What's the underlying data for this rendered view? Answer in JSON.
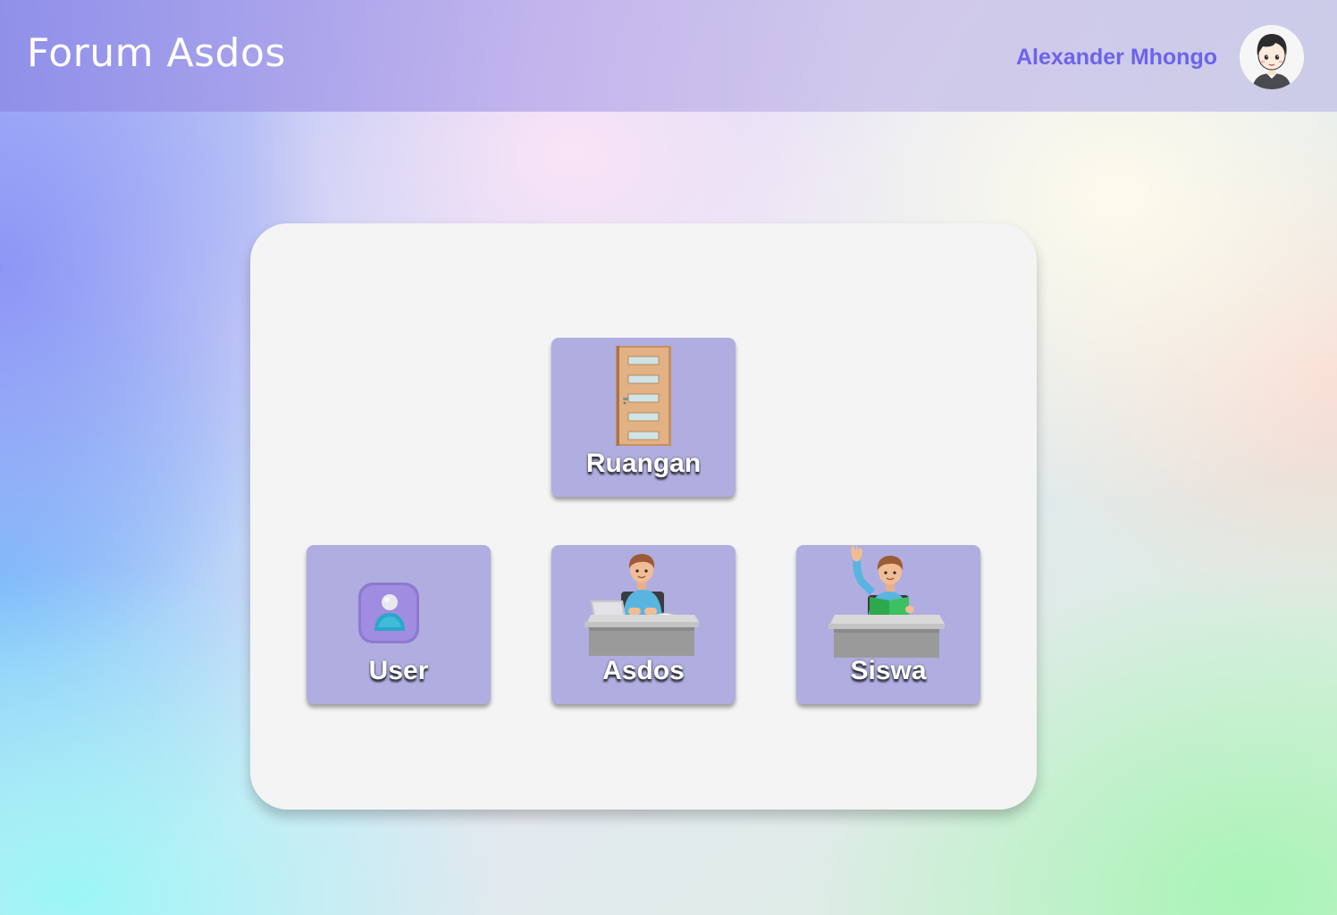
{
  "header": {
    "title": "Forum Asdos",
    "user_name": "Alexander Mhongo",
    "avatar_icon": "cartoon-avatar-icon"
  },
  "menu": {
    "tiles": [
      {
        "label": "Ruangan",
        "icon": "door-icon"
      },
      {
        "label": "User",
        "icon": "user-profile-icon"
      },
      {
        "label": "Asdos",
        "icon": "teacher-at-desk-icon"
      },
      {
        "label": "Siswa",
        "icon": "student-raising-hand-icon"
      }
    ]
  },
  "colors": {
    "header_text": "#ffffff",
    "user_name": "#6c63ec",
    "tile_bg": "#b0ade0",
    "panel_bg": "#f4f4f4"
  }
}
